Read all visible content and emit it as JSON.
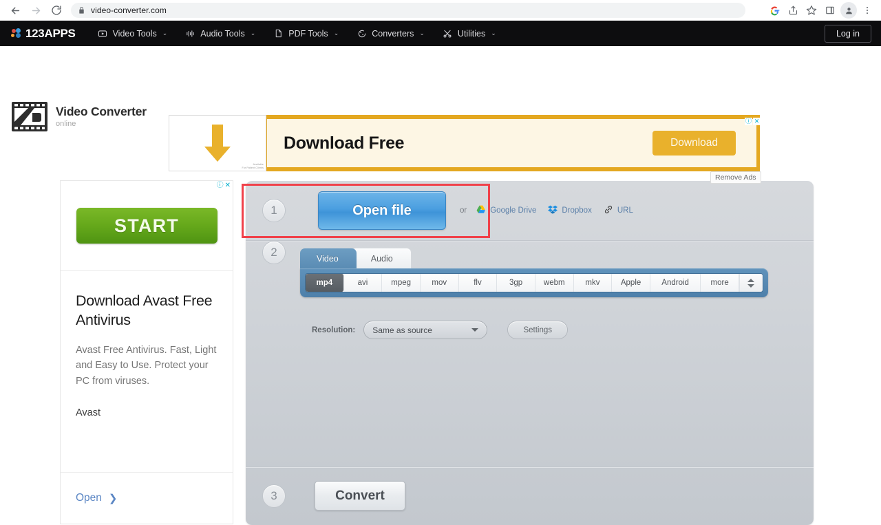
{
  "browser": {
    "url": "video-converter.com",
    "back_icon": "arrow-left-icon",
    "forward_icon": "arrow-right-icon",
    "reload_icon": "reload-icon",
    "lock_icon": "lock-icon",
    "right_icons": [
      "google-logo-icon",
      "share-icon",
      "bookmark-star-icon",
      "sidepanel-icon",
      "profile-avatar-icon",
      "more-menu-icon"
    ],
    "g_label": "G"
  },
  "site_header": {
    "brand": "123APPS",
    "nav": [
      {
        "label": "Video Tools",
        "icon": "play-square-icon",
        "caret": "⌄"
      },
      {
        "label": "Audio Tools",
        "icon": "audio-wave-icon",
        "caret": "⌄"
      },
      {
        "label": "PDF Tools",
        "icon": "document-icon",
        "caret": "⌄"
      },
      {
        "label": "Converters",
        "icon": "converter-circle-icon",
        "caret": "⌄"
      },
      {
        "label": "Utilities",
        "icon": "scissors-icon",
        "caret": "⌄"
      }
    ],
    "login_label": "Log in"
  },
  "app_logo": {
    "icon": "film-strip-icon",
    "title": "Video Converter",
    "subtitle": "online"
  },
  "top_ad": {
    "arrow_icon": "down-arrow-icon",
    "credit_line1": "Available",
    "credit_line2": "For Patient Clients",
    "headline": "Download Free",
    "cta_label": "Download",
    "info_badge": "ⓘ",
    "close_badge": "✕"
  },
  "remove_ads_label": "Remove Ads",
  "side_ad": {
    "info_badge": "ⓘ",
    "close_badge": "✕",
    "start_label": "START",
    "title": "Download Avast Free Antivirus",
    "description": "Avast Free Antivirus. Fast, Light and Easy to Use. Protect your PC from viruses.",
    "brand": "Avast",
    "open_label": "Open",
    "open_chevron": "❯"
  },
  "converter": {
    "step1": {
      "number": "1",
      "open_file_label": "Open file",
      "or_label": "or",
      "cloud_links": [
        {
          "label": "Google Drive",
          "icon": "google-drive-icon"
        },
        {
          "label": "Dropbox",
          "icon": "dropbox-icon"
        },
        {
          "label": "URL",
          "icon": "link-icon"
        }
      ]
    },
    "step2": {
      "number": "2",
      "tabs": [
        {
          "label": "Video",
          "active": true
        },
        {
          "label": "Audio",
          "active": false
        }
      ],
      "formats": [
        "mp4",
        "avi",
        "mpeg",
        "mov",
        "flv",
        "3gp",
        "webm",
        "mkv",
        "Apple",
        "Android",
        "more"
      ],
      "selected_format": "mp4",
      "spinner_icon": "up-down-spinner-icon",
      "resolution_label": "Resolution:",
      "resolution_value": "Same as source",
      "settings_label": "Settings"
    },
    "step3": {
      "number": "3",
      "convert_label": "Convert"
    }
  },
  "annotation": {
    "highlight_color": "#f0414a",
    "target": "step1-open-file-row"
  },
  "colors": {
    "header_bg": "#0d0d0f",
    "panel_bg": "#cfd3d8",
    "open_file_blue": "#4b9fe0",
    "format_bar_blue": "#5f92bb",
    "start_green": "#66a91b",
    "ad_yellow": "#e4a821",
    "highlight_red": "#f0414a"
  }
}
